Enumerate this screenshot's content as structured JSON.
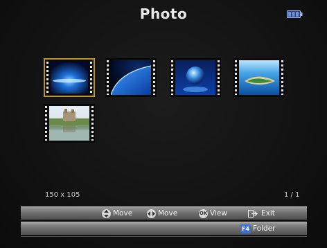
{
  "header": {
    "title": "Photo",
    "battery_icon": "battery-icon",
    "battery_color": "#6f8fd8"
  },
  "thumbnails": [
    {
      "name": "thumb-1",
      "icon": "blue-glow-horizon",
      "selected": true
    },
    {
      "name": "thumb-2",
      "icon": "blue-planet-arc",
      "selected": false
    },
    {
      "name": "thumb-3",
      "icon": "globe",
      "selected": false
    },
    {
      "name": "thumb-4",
      "icon": "island-aerial",
      "selected": false
    },
    {
      "name": "thumb-5",
      "icon": "castle-lake",
      "selected": false
    }
  ],
  "status": {
    "resolution": "150 x 105",
    "page": "1 / 1"
  },
  "bar1": {
    "move_ud_icon": "up-down-arrow-icon",
    "move_ud_label": "Move",
    "move_lr_icon": "left-right-arrow-icon",
    "move_lr_label": "Move",
    "ok_key": "OK",
    "view_label": "View",
    "exit_icon": "exit-arrow-icon",
    "exit_label": "Exit"
  },
  "bar2": {
    "folder_key": "F4",
    "folder_label": "Folder"
  },
  "colors": {
    "selection_border": "#b8942a",
    "bar_gray": "#7a7a7a",
    "f4_key": "#3d6fd6"
  }
}
